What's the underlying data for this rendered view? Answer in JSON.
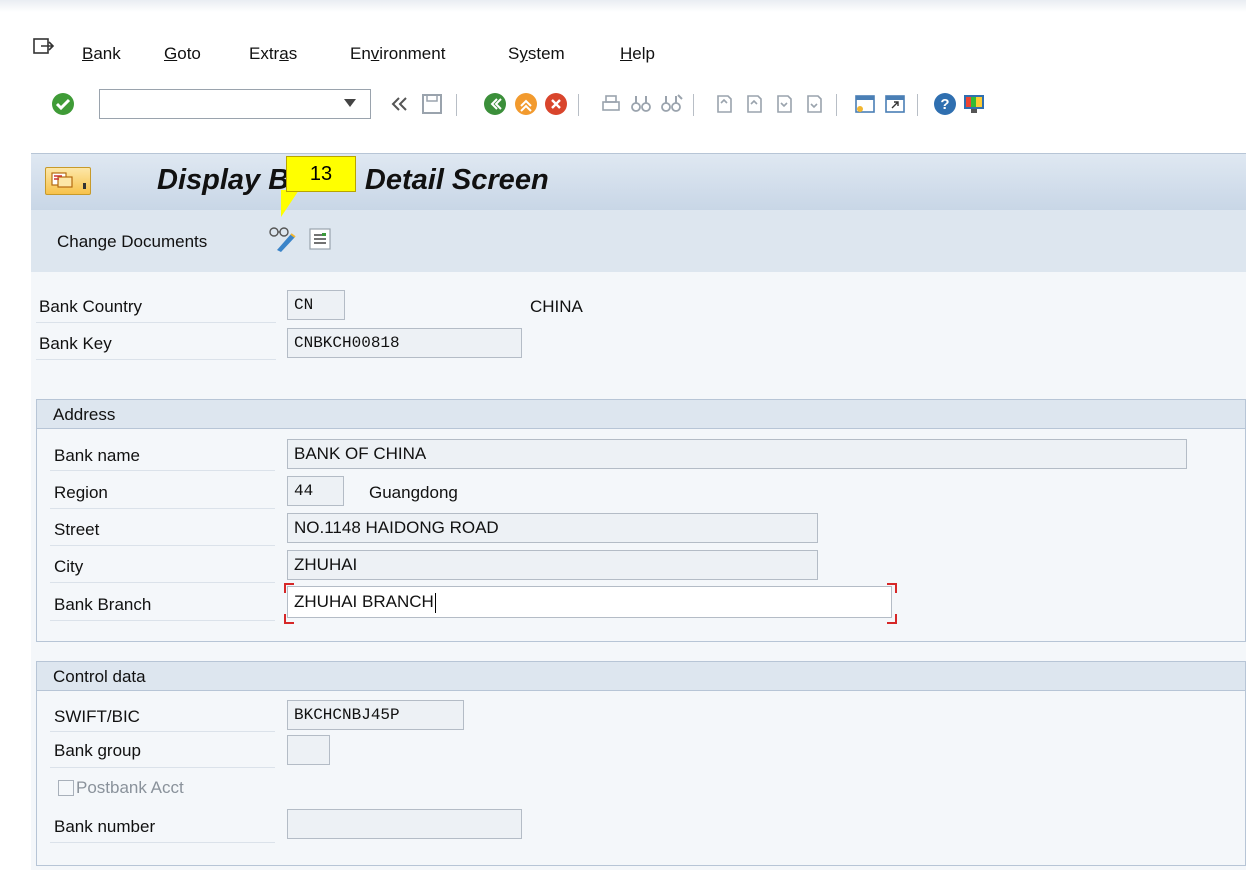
{
  "menu": {
    "items": [
      {
        "label": "Bank",
        "ul": "B"
      },
      {
        "label": "Goto",
        "ul": "G"
      },
      {
        "label": "Extras",
        "ul": "a"
      },
      {
        "label": "Environment",
        "ul": "v"
      },
      {
        "label": "System",
        "ul": "y"
      },
      {
        "label": "Help",
        "ul": "H"
      }
    ]
  },
  "toolbar": {
    "command_field_value": ""
  },
  "title": {
    "text": "Display Bank : Detail Screen",
    "callout": "13"
  },
  "appbar": {
    "change_documents": "Change Documents"
  },
  "header_fields": {
    "bank_country_label": "Bank Country",
    "bank_country_value": "CN",
    "bank_country_name": "CHINA",
    "bank_key_label": "Bank Key",
    "bank_key_value": "CNBKCH00818"
  },
  "address": {
    "title": "Address",
    "bank_name_label": "Bank name",
    "bank_name_value": "BANK OF CHINA",
    "region_label": "Region",
    "region_value": "44",
    "region_name": "Guangdong",
    "street_label": "Street",
    "street_value": "NO.1148 HAIDONG ROAD",
    "city_label": "City",
    "city_value": "ZHUHAI",
    "bank_branch_label": "Bank Branch",
    "bank_branch_value": "ZHUHAI BRANCH"
  },
  "control": {
    "title": "Control data",
    "swift_label": "SWIFT/BIC",
    "swift_value": "BKCHCNBJ45P",
    "bank_group_label": "Bank group",
    "bank_group_value": "",
    "postbank_label": "Postbank Acct",
    "bank_number_label": "Bank number",
    "bank_number_value": ""
  },
  "colors": {
    "accent": "#dde6ef",
    "focus": "#d62828",
    "callout": "#ffff00"
  }
}
